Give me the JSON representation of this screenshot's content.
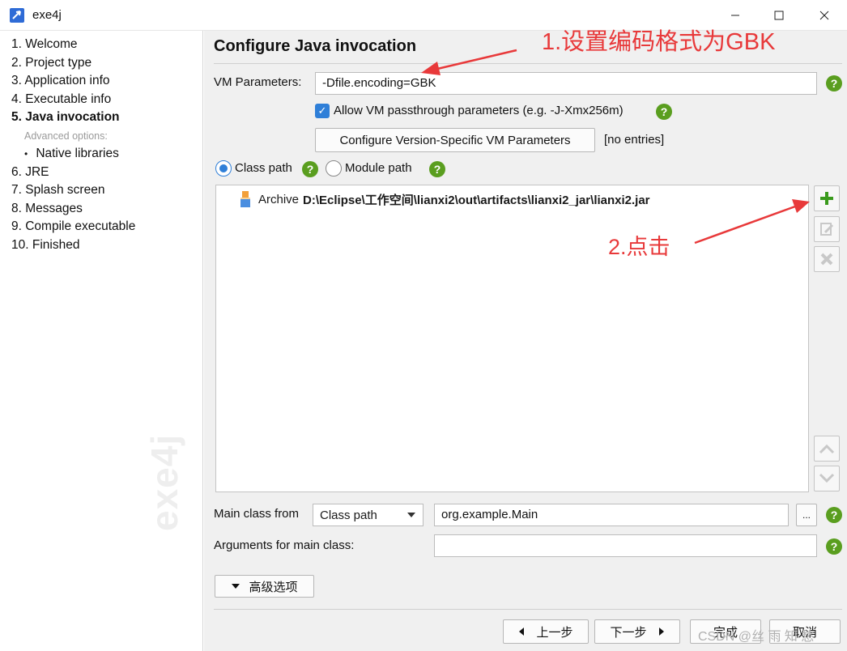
{
  "window": {
    "title": "exe4j"
  },
  "nav": {
    "items": [
      {
        "label": "1. Welcome",
        "active": false
      },
      {
        "label": "2. Project type",
        "active": false
      },
      {
        "label": "3. Application info",
        "active": false
      },
      {
        "label": "4. Executable info",
        "active": false
      },
      {
        "label": "5. Java invocation",
        "active": true
      }
    ],
    "advanced_title": "Advanced options:",
    "advanced_items": [
      {
        "label": "Native libraries"
      }
    ],
    "items_after": [
      {
        "label": "6. JRE"
      },
      {
        "label": "7. Splash screen"
      },
      {
        "label": "8. Messages"
      },
      {
        "label": "9. Compile executable"
      },
      {
        "label": "10. Finished"
      }
    ],
    "watermark": "exe4j"
  },
  "page": {
    "title": "Configure Java invocation",
    "vm_params_label": "VM Parameters:",
    "vm_params_value": "-Dfile.encoding=GBK",
    "allow_passthrough_label": "Allow VM passthrough parameters (e.g. -J-Xmx256m)",
    "allow_passthrough_checked": true,
    "config_version_button": "Configure Version-Specific VM Parameters",
    "no_entries": "[no entries]",
    "classpath_radio": "Class path",
    "modulepath_radio": "Module path",
    "selected_path_mode": "Class path",
    "classpath_entries": [
      {
        "kind": "Archive",
        "path": "D:\\Eclipse\\工作空间\\lianxi2\\out\\artifacts\\lianxi2_jar\\lianxi2.jar"
      }
    ],
    "main_class_from_label": "Main class from",
    "main_class_from_value": "Class path",
    "main_class_value": "org.example.Main",
    "browse_label": "...",
    "args_label": "Arguments for main class:",
    "args_value": "",
    "advanced_button": "高级选项"
  },
  "footer": {
    "back": "上一步",
    "next": "下一步",
    "finish": "完成",
    "cancel": "取消"
  },
  "annotations": {
    "step1": "1.设置编码格式为GBK",
    "step2": "2.点击",
    "color": "#e8393a"
  },
  "watermark_text": "CSDN @丝 雨 知 愁",
  "colors": {
    "accent_blue": "#2f7fd8",
    "help_green": "#5a9e1f",
    "add_green": "#3a9a1c"
  }
}
